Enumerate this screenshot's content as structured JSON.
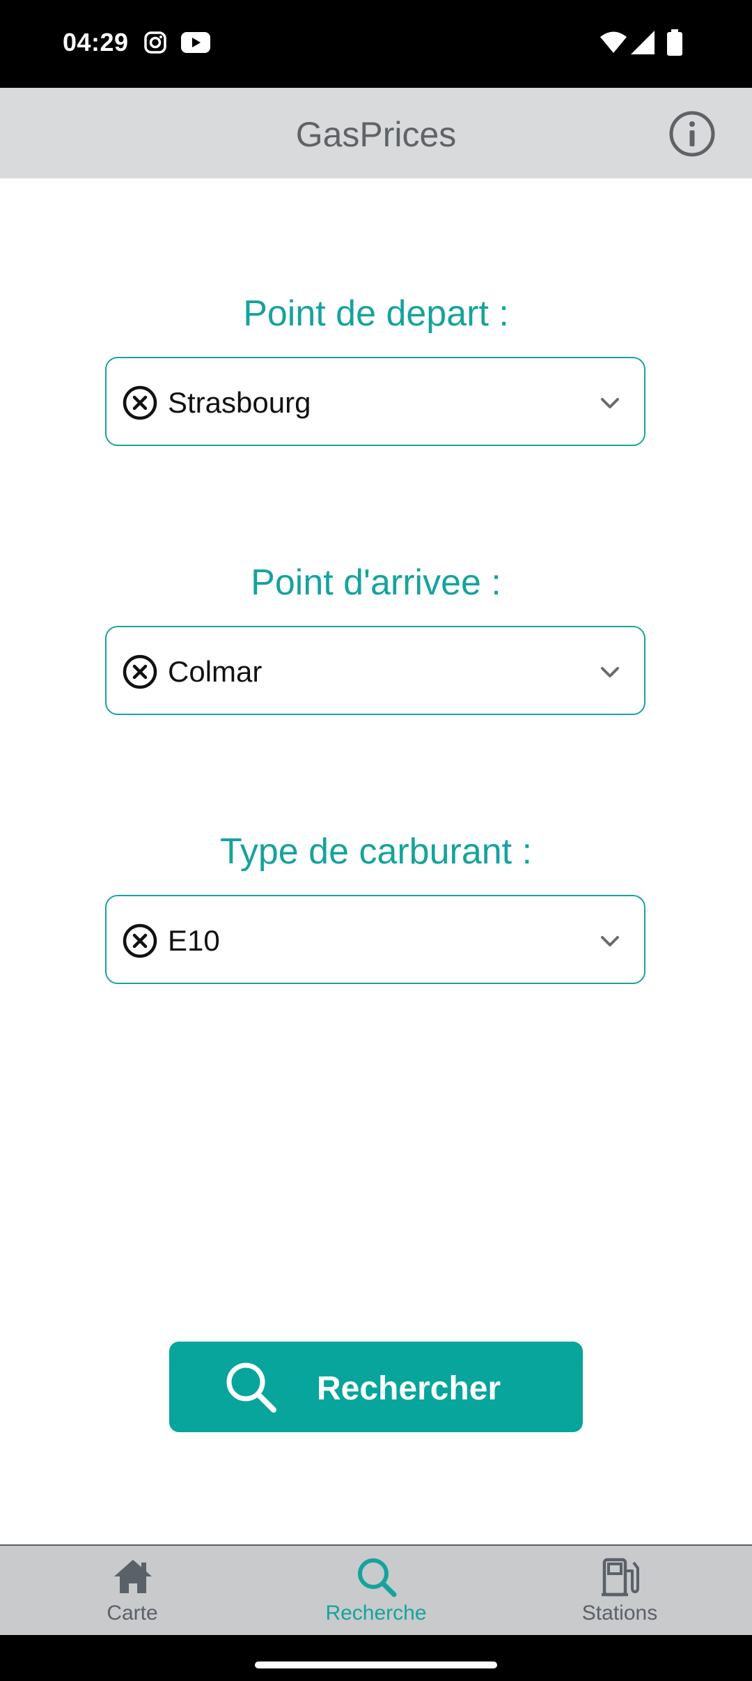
{
  "status_bar": {
    "time": "04:29",
    "notification_icons": [
      "instagram-icon",
      "youtube-icon"
    ],
    "system_icons": [
      "wifi-icon",
      "cell-signal-icon",
      "battery-icon"
    ]
  },
  "app_bar": {
    "title": "GasPrices",
    "info_icon": "info-icon"
  },
  "form": {
    "departure": {
      "label": "Point de depart :",
      "value": "Strasbourg"
    },
    "arrival": {
      "label": "Point d'arrivee :",
      "value": "Colmar"
    },
    "fuel": {
      "label": "Type de carburant :",
      "value": "E10"
    }
  },
  "search_button": {
    "label": "Rechercher",
    "icon": "search-icon"
  },
  "bottom_nav": {
    "items": [
      {
        "label": "Carte",
        "icon": "home-icon",
        "active": false
      },
      {
        "label": "Recherche",
        "icon": "search-icon",
        "active": true
      },
      {
        "label": "Stations",
        "icon": "gas-pump-icon",
        "active": false
      }
    ]
  },
  "colors": {
    "accent": "#16a39c",
    "button": "#07a59c",
    "app_bar_bg": "#d9dadb",
    "bottom_nav_bg": "#c8cacc",
    "inactive": "#5b6168"
  }
}
